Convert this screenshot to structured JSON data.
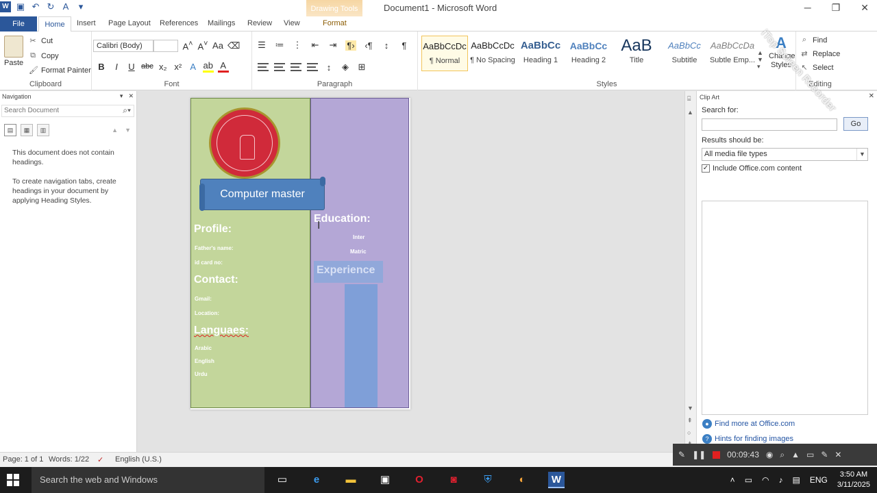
{
  "window": {
    "title": "Document1 - Microsoft Word",
    "context_tab_group": "Drawing Tools"
  },
  "tabs": [
    "File",
    "Home",
    "Insert",
    "Page Layout",
    "References",
    "Mailings",
    "Review",
    "View",
    "Format"
  ],
  "clipboard": {
    "paste": "Paste",
    "cut": "Cut",
    "copy": "Copy",
    "format_painter": "Format Painter",
    "group_label": "Clipboard"
  },
  "font": {
    "name": "Calibri (Body)",
    "size": "",
    "group_label": "Font"
  },
  "paragraph": {
    "group_label": "Paragraph"
  },
  "styles": {
    "group_label": "Styles",
    "change_styles": "Change Styles",
    "items": [
      {
        "preview": "AaBbCcDc",
        "name": "¶ Normal"
      },
      {
        "preview": "AaBbCcDc",
        "name": "¶ No Spacing"
      },
      {
        "preview": "AaBbCc",
        "name": "Heading 1"
      },
      {
        "preview": "AaBbCc",
        "name": "Heading 2"
      },
      {
        "preview": "AaB",
        "name": "Title"
      },
      {
        "preview": "AaBbCc",
        "name": "Subtitle"
      },
      {
        "preview": "AaBbCcDa",
        "name": "Subtle Emp..."
      }
    ]
  },
  "editing": {
    "find": "Find",
    "replace": "Replace",
    "select": "Select",
    "group_label": "Editing"
  },
  "navigation": {
    "title": "Navigation",
    "search_placeholder": "Search Document",
    "message1": "This document does not contain headings.",
    "message2": "To create navigation tabs, create headings in your document by applying Heading Styles."
  },
  "document": {
    "banner": "Computer master",
    "profile": "Profile:",
    "fathers_name": "Father's name:",
    "id_card": "id card no:",
    "contact": "Contact:",
    "gmail": "Gmail:",
    "location": "Location:",
    "languages": "Languaes:",
    "lang_list": [
      "Arabic",
      "English",
      "Urdu"
    ],
    "education": "Education:",
    "edu_list": [
      "Inter",
      "Matric"
    ],
    "experience": "Experience"
  },
  "clipart": {
    "title": "Clip Art",
    "search_for": "Search for:",
    "go": "Go",
    "results_label": "Results should be:",
    "results_value": "All media file types",
    "include_office": "Include Office.com content",
    "find_more": "Find more at Office.com",
    "hints": "Hints for finding images"
  },
  "status": {
    "page": "Page: 1 of 1",
    "words": "Words: 1/22",
    "language": "English (U.S.)"
  },
  "recorder": {
    "time": "00:09:43",
    "watermark": "iTop Screen Recorder"
  },
  "taskbar": {
    "search_placeholder": "Search the web and Windows",
    "language": "ENG",
    "time": "3:50 AM",
    "date": "3/11/2025"
  },
  "colors": {
    "word_blue": "#2b579a",
    "left_column": "#c3d69b",
    "right_column": "#b4a7d6",
    "banner": "#4f81bd",
    "logo_red": "#d02a3a"
  }
}
